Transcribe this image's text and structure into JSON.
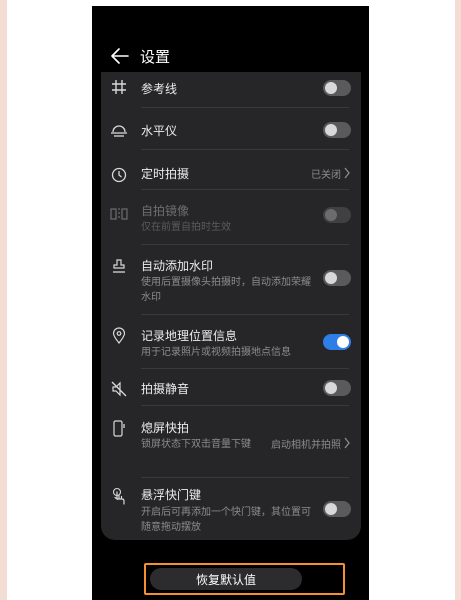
{
  "header": {
    "title": "设置"
  },
  "settings": [
    {
      "label": "参考线",
      "toggle": false
    },
    {
      "label": "水平仪",
      "toggle": false
    },
    {
      "label": "定时拍摄",
      "value": "已关闭"
    },
    {
      "label": "自拍镜像",
      "sub": "仅在前置自拍时生效",
      "toggle": false,
      "disabled": true
    },
    {
      "label": "自动添加水印",
      "sub": "使用后置摄像头拍摄时，自动添加荣耀水印",
      "toggle": false
    },
    {
      "label": "记录地理位置信息",
      "sub": "用于记录照片或视频拍摄地点信息",
      "toggle": true
    },
    {
      "label": "拍摄静音",
      "toggle": false
    },
    {
      "label": "熄屏快拍",
      "sub": "锁屏状态下双击音量下键",
      "value": "启动相机并拍照"
    },
    {
      "label": "悬浮快门键",
      "sub": "开启后可再添加一个快门键，其位置可随意拖动摆放",
      "toggle": false
    }
  ],
  "footer": {
    "reset_label": "恢复默认值"
  },
  "colors": {
    "accent": "#2f7ee8",
    "highlight": "#f39131"
  }
}
